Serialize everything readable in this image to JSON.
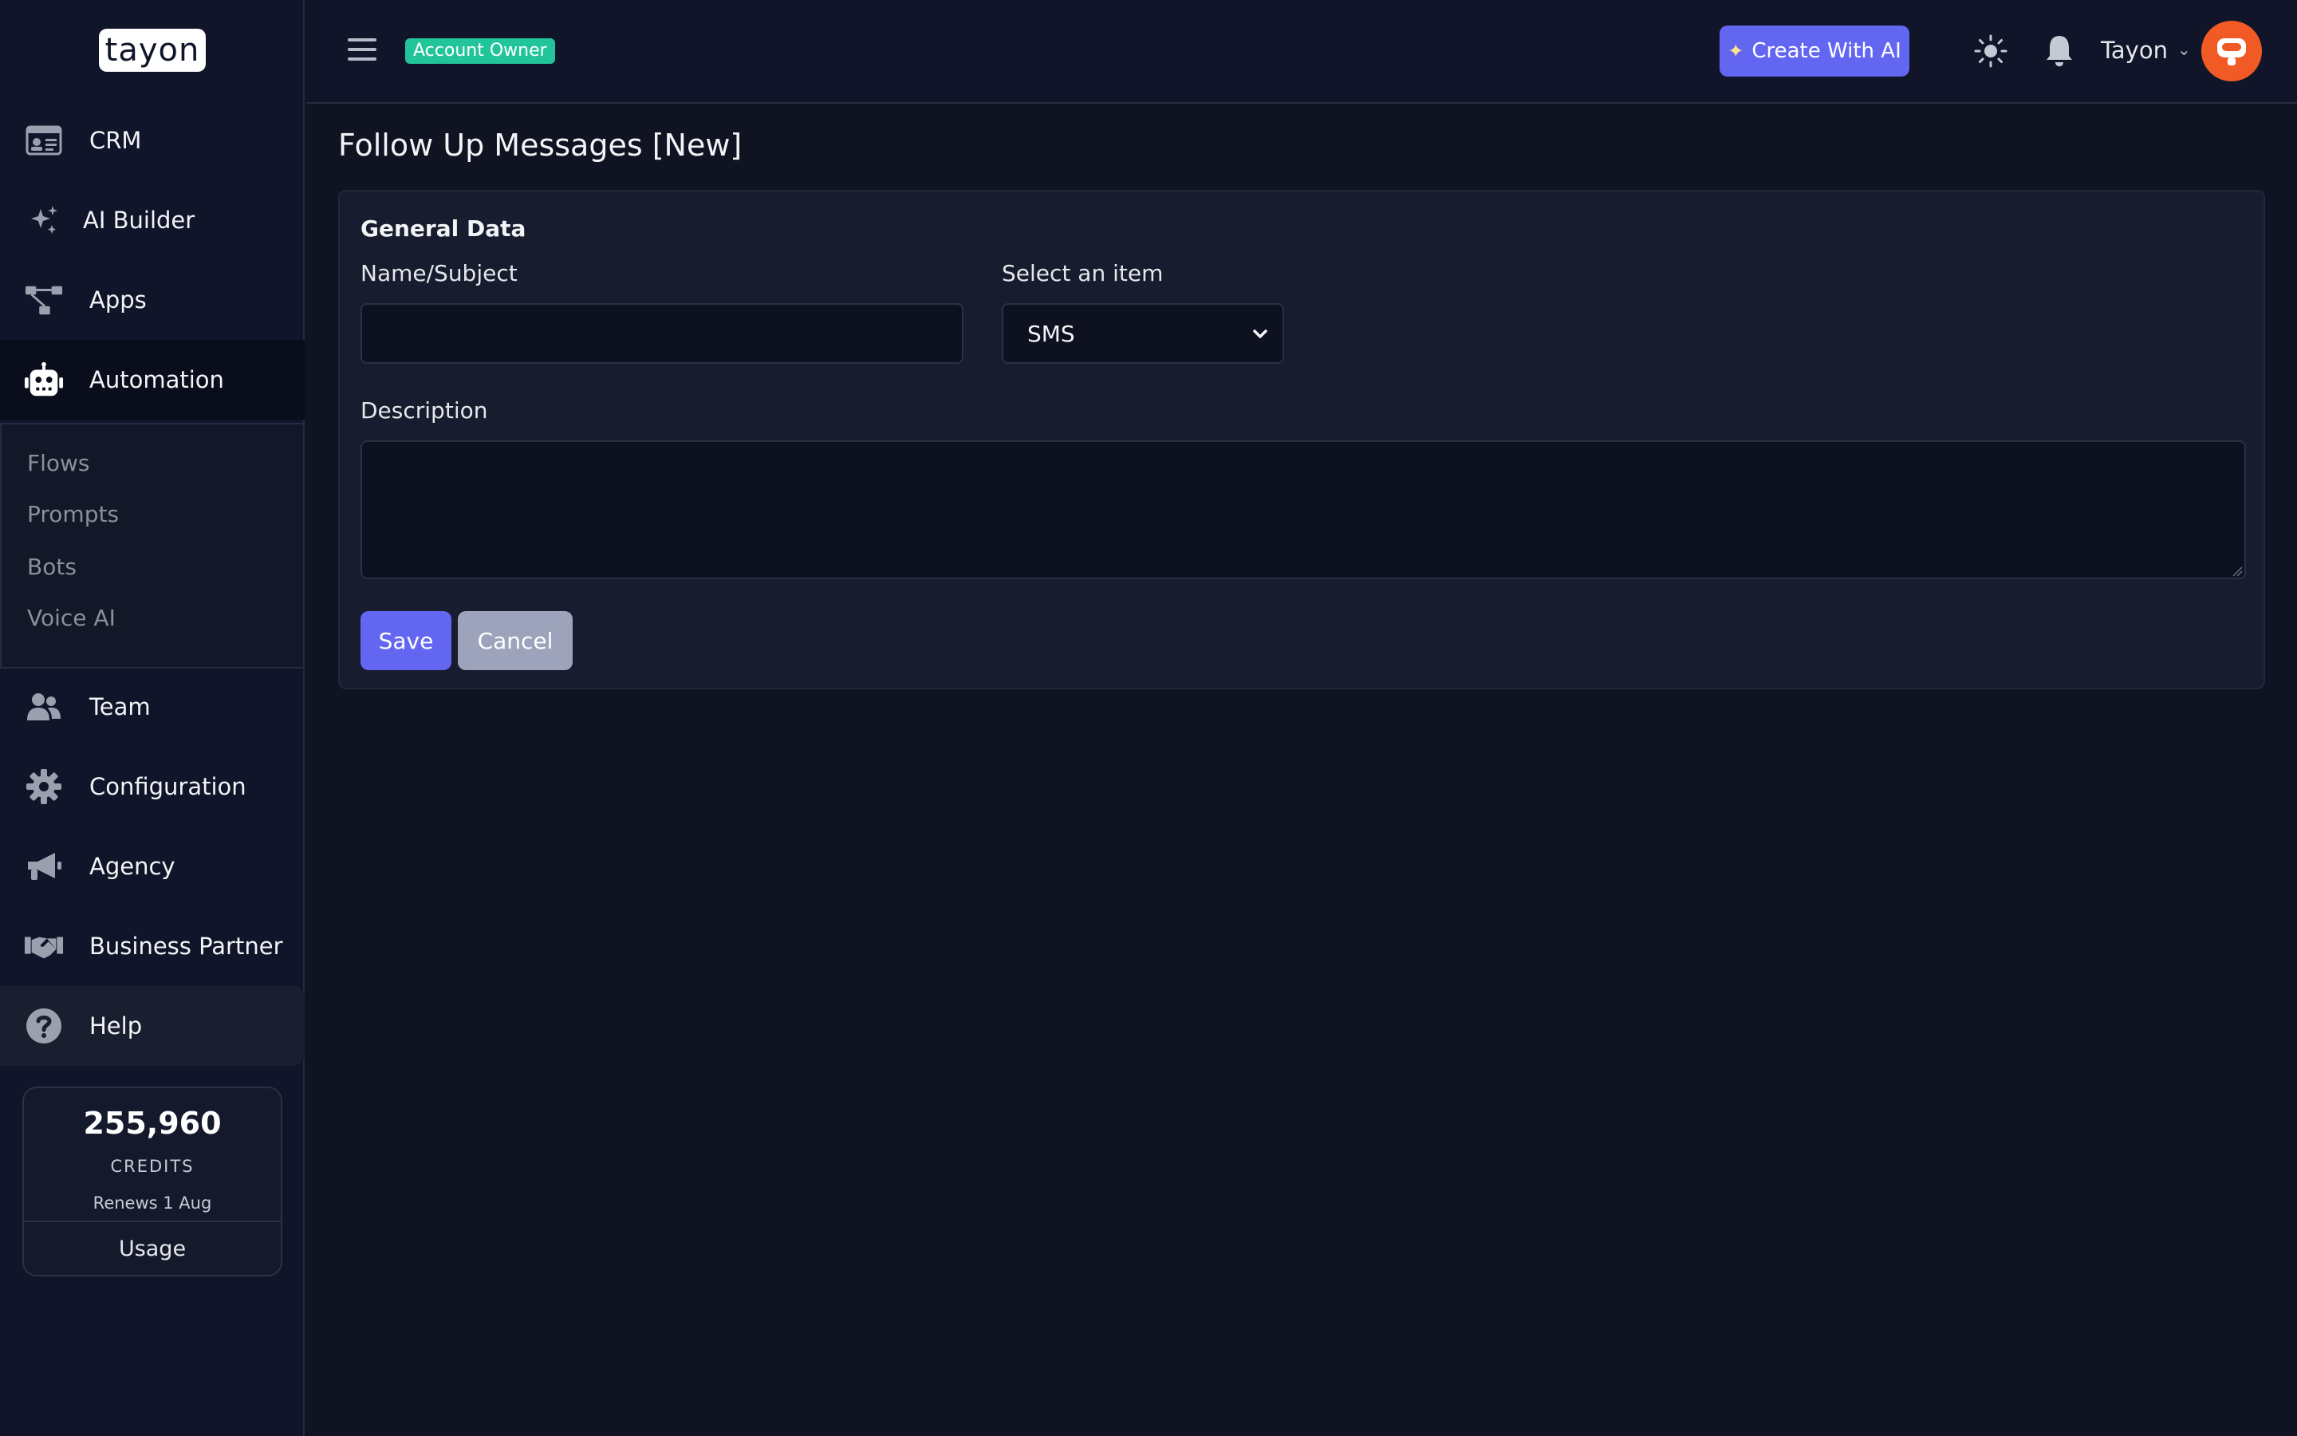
{
  "logo": {
    "text": "tayon"
  },
  "sidebar": {
    "items": [
      {
        "label": "CRM",
        "icon": "id-card-icon"
      },
      {
        "label": "AI Builder",
        "icon": "sparkles-icon"
      },
      {
        "label": "Apps",
        "icon": "sitemap-icon"
      },
      {
        "label": "Automation",
        "icon": "robot-icon",
        "active": true
      },
      {
        "label": "Team",
        "icon": "users-icon"
      },
      {
        "label": "Configuration",
        "icon": "gear-icon"
      },
      {
        "label": "Agency",
        "icon": "megaphone-icon"
      },
      {
        "label": "Business Partner",
        "icon": "handshake-icon"
      },
      {
        "label": "Help",
        "icon": "question-circle-icon"
      }
    ],
    "submenu": [
      "Flows",
      "Prompts",
      "Bots",
      "Voice AI"
    ]
  },
  "credits": {
    "amount": "255,960",
    "label": "CREDITS",
    "renews": "Renews 1 Aug",
    "usage_label": "Usage"
  },
  "header": {
    "badge": "Account Owner",
    "create_label": "Create With AI",
    "user_name": "Tayon"
  },
  "page": {
    "title": "Follow Up Messages [New]"
  },
  "form": {
    "section_title": "General Data",
    "name_label": "Name/Subject",
    "name_value": "",
    "select_label": "Select an item",
    "select_value": "SMS",
    "description_label": "Description",
    "description_value": "",
    "save_label": "Save",
    "cancel_label": "Cancel"
  },
  "colors": {
    "accent": "#6366f1",
    "badge": "#22c59a",
    "avatar": "#f15a24",
    "background": "#0f1322"
  }
}
